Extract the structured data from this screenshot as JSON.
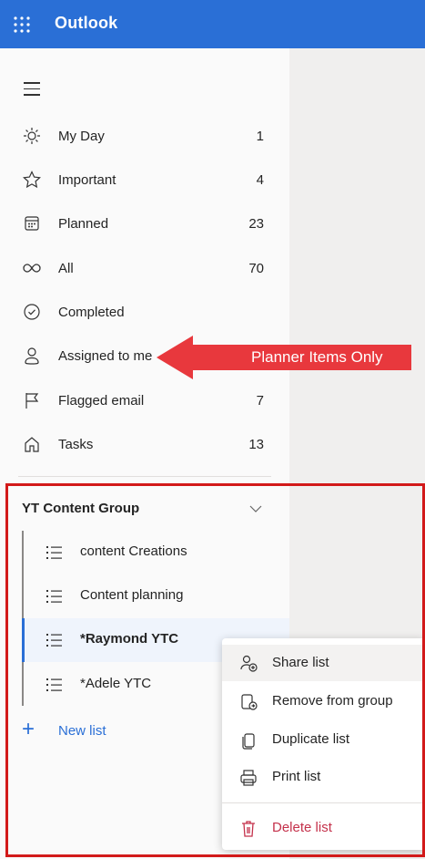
{
  "header": {
    "app_title": "Outlook",
    "waffle_icon": "waffle-icon"
  },
  "nav": {
    "items": [
      {
        "icon": "sun-icon",
        "label": "My Day",
        "count": "1"
      },
      {
        "icon": "star-icon",
        "label": "Important",
        "count": "4"
      },
      {
        "icon": "calendar-icon",
        "label": "Planned",
        "count": "23"
      },
      {
        "icon": "infinity-icon",
        "label": "All",
        "count": "70"
      },
      {
        "icon": "check-circle-icon",
        "label": "Completed",
        "count": ""
      },
      {
        "icon": "person-icon",
        "label": "Assigned to me",
        "count": ""
      },
      {
        "icon": "flag-icon",
        "label": "Flagged email",
        "count": "7"
      },
      {
        "icon": "home-icon",
        "label": "Tasks",
        "count": "13"
      }
    ]
  },
  "group": {
    "title": "YT Content Group",
    "lists": [
      {
        "label": "content Creations",
        "selected": false
      },
      {
        "label": "Content planning",
        "selected": false
      },
      {
        "label": "*Raymond YTC",
        "selected": true
      },
      {
        "label": "*Adele YTC",
        "selected": false
      }
    ],
    "new_list_label": "New list"
  },
  "context_menu": {
    "items": [
      {
        "icon": "share-person-icon",
        "label": "Share list"
      },
      {
        "icon": "remove-group-icon",
        "label": "Remove from group"
      },
      {
        "icon": "duplicate-icon",
        "label": "Duplicate list"
      },
      {
        "icon": "printer-icon",
        "label": "Print list"
      },
      {
        "icon": "trash-icon",
        "label": "Delete list"
      }
    ]
  },
  "annotation": {
    "text": "Planner Items Only"
  },
  "colors": {
    "brand": "#2a6fd6",
    "annotation_red": "#e8383d",
    "box_red": "#d21a1a",
    "danger": "#c4314b"
  }
}
